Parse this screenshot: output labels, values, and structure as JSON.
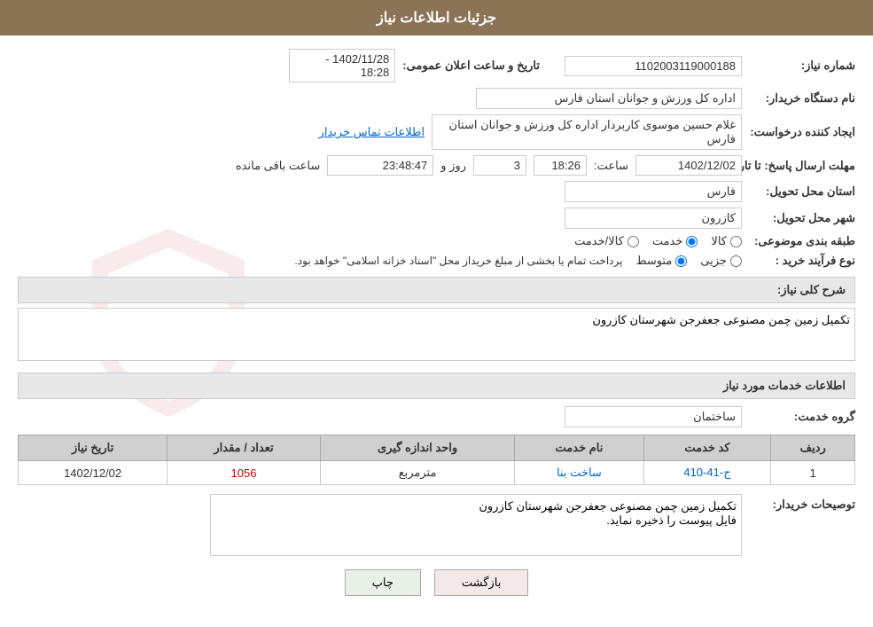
{
  "header": {
    "title": "جزئیات اطلاعات نیاز"
  },
  "fields": {
    "need_number_label": "شماره نیاز:",
    "need_number_value": "1102003119000188",
    "announce_datetime_label": "تاریخ و ساعت اعلان عمومی:",
    "announce_datetime_value": "1402/11/28 - 18:28",
    "buyer_org_label": "نام دستگاه خریدار:",
    "buyer_org_value": "اداره کل ورزش و جوانان استان فارس",
    "creator_label": "ایجاد کننده درخواست:",
    "creator_value": "غلام حسین موسوی کاربردار اداره کل ورزش و جوانان استان فارس",
    "contact_link": "اطلاعات تماس خریدار",
    "reply_deadline_label": "مهلت ارسال پاسخ: تا تاریخ:",
    "reply_date": "1402/12/02",
    "reply_time_label": "ساعت:",
    "reply_time": "18:26",
    "reply_days_label": "روز و",
    "reply_days": "3",
    "reply_remaining_label": "ساعت باقی مانده",
    "reply_remaining": "23:48:47",
    "province_label": "استان محل تحویل:",
    "province_value": "فارس",
    "city_label": "شهر محل تحویل:",
    "city_value": "کازرون",
    "category_label": "طبقه بندی موضوعی:",
    "category_radio1": "کالا",
    "category_radio2": "خدمت",
    "category_radio3": "کالا/خدمت",
    "category_selected": "خدمت",
    "purchase_type_label": "نوع فرآیند خرید :",
    "purchase_radio1": "جزیی",
    "purchase_radio2": "متوسط",
    "purchase_note": "پرداخت تمام یا بخشی از مبلغ خریداز محل \"اسناد خزانه اسلامی\" خواهد بود.",
    "need_description_label": "شرح کلی نیاز:",
    "need_description_value": "تکمیل زمین چمن مصنوعی جعفرجن شهرستان کازرون",
    "services_section_label": "اطلاعات خدمات مورد نیاز",
    "service_group_label": "گروه خدمت:",
    "service_group_value": "ساختمان",
    "table": {
      "col_row": "ردیف",
      "col_code": "کد خدمت",
      "col_name": "نام خدمت",
      "col_unit": "واحد اندازه گیری",
      "col_quantity": "تعداد / مقدار",
      "col_date": "تاریخ نیاز",
      "rows": [
        {
          "row": "1",
          "code": "ج-41-410",
          "name": "ساخت بنا",
          "unit": "مترمربع",
          "quantity": "1056",
          "date": "1402/12/02"
        }
      ]
    },
    "buyer_notes_label": "توصیحات خریدار:",
    "buyer_notes_value": "تکمیل زمین چمن مصنوعی جعفرجن شهرستان کازرون\nفایل پیوست را ذخیره نماید."
  },
  "buttons": {
    "print": "چاپ",
    "back": "بازگشت"
  }
}
